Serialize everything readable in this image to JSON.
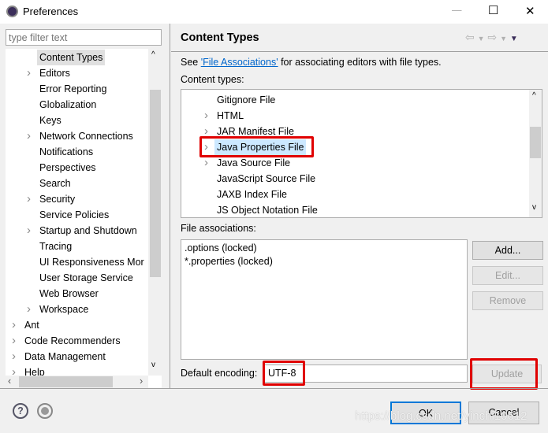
{
  "window": {
    "title": "Preferences",
    "minimize": "—",
    "maximize": "☐",
    "close": "✕"
  },
  "sidebar": {
    "filter_placeholder": "type filter text",
    "items": [
      {
        "label": "Content Types",
        "level": 2,
        "expandable": false,
        "selected": true
      },
      {
        "label": "Editors",
        "level": 2,
        "expandable": true
      },
      {
        "label": "Error Reporting",
        "level": 2,
        "expandable": false
      },
      {
        "label": "Globalization",
        "level": 2,
        "expandable": false
      },
      {
        "label": "Keys",
        "level": 2,
        "expandable": false
      },
      {
        "label": "Network Connections",
        "level": 2,
        "expandable": true
      },
      {
        "label": "Notifications",
        "level": 2,
        "expandable": false
      },
      {
        "label": "Perspectives",
        "level": 2,
        "expandable": false
      },
      {
        "label": "Search",
        "level": 2,
        "expandable": false
      },
      {
        "label": "Security",
        "level": 2,
        "expandable": true
      },
      {
        "label": "Service Policies",
        "level": 2,
        "expandable": false
      },
      {
        "label": "Startup and Shutdown",
        "level": 2,
        "expandable": true
      },
      {
        "label": "Tracing",
        "level": 2,
        "expandable": false
      },
      {
        "label": "UI Responsiveness Mor",
        "level": 2,
        "expandable": false
      },
      {
        "label": "User Storage Service",
        "level": 2,
        "expandable": false
      },
      {
        "label": "Web Browser",
        "level": 2,
        "expandable": false
      },
      {
        "label": "Workspace",
        "level": 2,
        "expandable": true
      },
      {
        "label": "Ant",
        "level": 1,
        "expandable": true
      },
      {
        "label": "Code Recommenders",
        "level": 1,
        "expandable": true
      },
      {
        "label": "Data Management",
        "level": 1,
        "expandable": true
      },
      {
        "label": "Help",
        "level": 1,
        "expandable": true
      }
    ]
  },
  "main": {
    "title": "Content Types",
    "intro_pre": "See ",
    "intro_link": "'File Associations'",
    "intro_post": " for associating editors with file types.",
    "content_types_label": "Content types:",
    "content_types": [
      {
        "label": "Gitignore File",
        "expandable": false
      },
      {
        "label": "HTML",
        "expandable": true
      },
      {
        "label": "JAR Manifest File",
        "expandable": true
      },
      {
        "label": "Java Properties File",
        "expandable": true,
        "selected": true
      },
      {
        "label": "Java Source File",
        "expandable": true
      },
      {
        "label": "JavaScript Source File",
        "expandable": false
      },
      {
        "label": "JAXB Index File",
        "expandable": false
      },
      {
        "label": "JS Object Notation File",
        "expandable": false
      }
    ],
    "file_assoc_label": "File associations:",
    "file_associations": [
      ".options (locked)",
      "*.properties (locked)"
    ],
    "add": "Add...",
    "edit": "Edit...",
    "remove": "Remove",
    "encoding_label": "Default encoding:",
    "encoding_value": "UTF-8",
    "update": "Update"
  },
  "footer": {
    "ok": "OK",
    "cancel": "Cancel",
    "watermark": "https://blog.csdn.net/yinchi10612"
  },
  "colors": {
    "highlight": "#e00000",
    "link": "#0066cc",
    "selection": "#cce8ff"
  }
}
